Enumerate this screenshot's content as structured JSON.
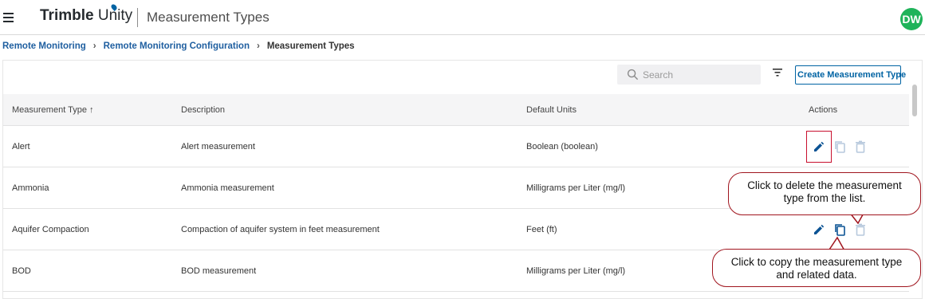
{
  "header": {
    "brand_bold": "Trimble",
    "brand_light": " Unity",
    "app_title": "Measurement Types",
    "avatar_initials": "DW",
    "avatar_color": "#1fb35a"
  },
  "breadcrumb": [
    {
      "label": "Remote Monitoring"
    },
    {
      "label": "Remote Monitoring Configuration"
    },
    {
      "label": "Measurement Types"
    }
  ],
  "toolbar": {
    "search_placeholder": "Search",
    "create_label": "Create Measurement Type"
  },
  "table": {
    "columns": [
      "Measurement Type ↑",
      "Description",
      "Default Units",
      "Actions"
    ],
    "rows": [
      {
        "type": "Alert",
        "description": "Alert measurement",
        "units": "Boolean (boolean)"
      },
      {
        "type": "Ammonia",
        "description": "Ammonia measurement",
        "units": "Milligrams per Liter (mg/l)"
      },
      {
        "type": "Aquifer Compaction",
        "description": "Compaction of aquifer system in feet measurement",
        "units": "Feet (ft)"
      },
      {
        "type": "BOD",
        "description": "BOD measurement",
        "units": "Milligrams per Liter (mg/l)"
      }
    ]
  },
  "annotations": {
    "delete_callout": "Click to delete the measurement type from the list.",
    "copy_callout": "Click to copy the measurement type and related data."
  },
  "colors": {
    "accent": "#0063a3",
    "highlight": "#c8102e",
    "callout_border": "#a0151e"
  }
}
